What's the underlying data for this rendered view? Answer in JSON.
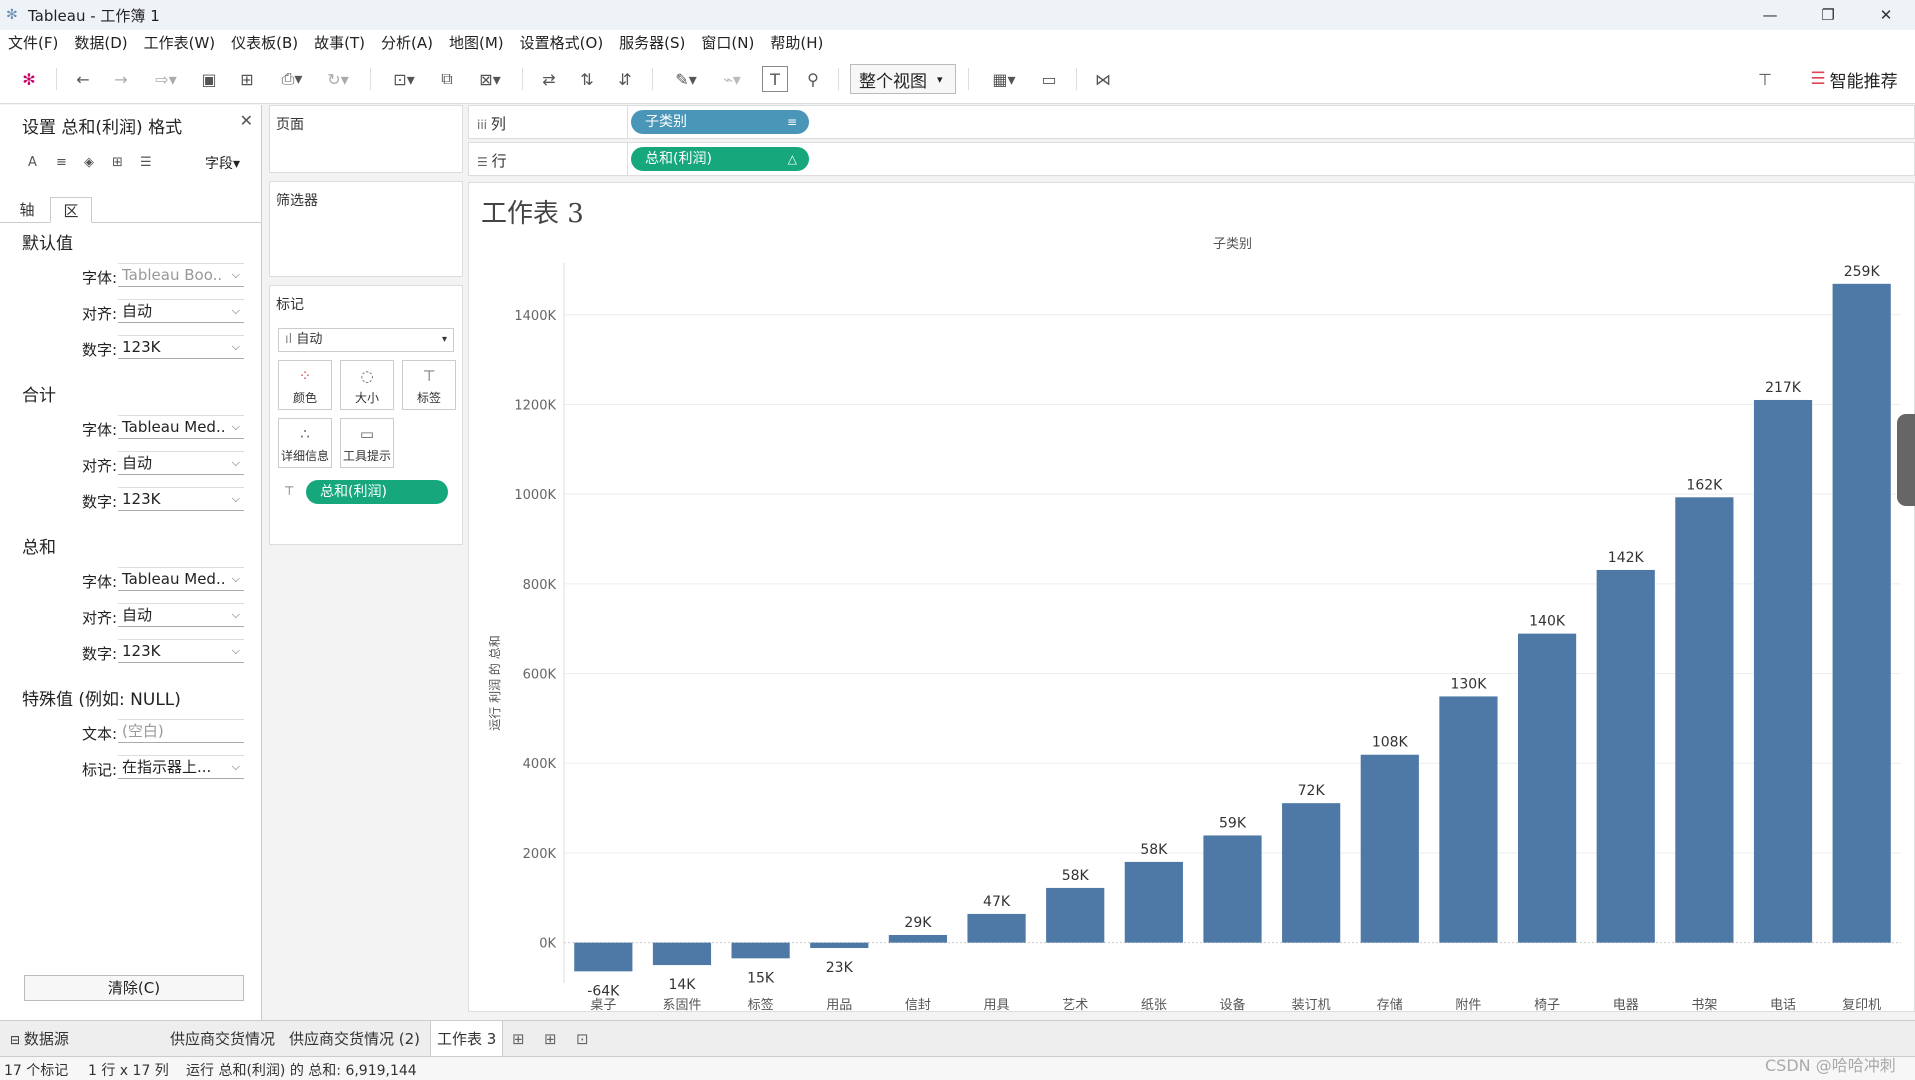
{
  "window": {
    "title": "Tableau - 工作簿 1",
    "minimize": "—",
    "maximize": "❐",
    "close": "✕"
  },
  "menu": [
    "文件(F)",
    "数据(D)",
    "工作表(W)",
    "仪表板(B)",
    "故事(T)",
    "分析(A)",
    "地图(M)",
    "设置格式(O)",
    "服务器(S)",
    "窗口(N)",
    "帮助(H)"
  ],
  "toolbar": {
    "fit_label": "整个视图",
    "show_me_label": "智能推荐"
  },
  "format_pane": {
    "title": "设置 总和(利润) 格式",
    "fields_label": "字段▾",
    "tabs": [
      "轴",
      "区"
    ],
    "sections": [
      {
        "title": "默认值",
        "rows": [
          {
            "label": "字体:",
            "value": "Tableau Boo..",
            "grey": true
          },
          {
            "label": "对齐:",
            "value": "自动"
          },
          {
            "label": "数字:",
            "value": "123K"
          }
        ]
      },
      {
        "title": "合计",
        "rows": [
          {
            "label": "字体:",
            "value": "Tableau Med.."
          },
          {
            "label": "对齐:",
            "value": "自动"
          },
          {
            "label": "数字:",
            "value": "123K"
          }
        ]
      },
      {
        "title": "总和",
        "rows": [
          {
            "label": "字体:",
            "value": "Tableau Med.."
          },
          {
            "label": "对齐:",
            "value": "自动"
          },
          {
            "label": "数字:",
            "value": "123K"
          }
        ]
      },
      {
        "title": "特殊值 (例如: NULL)",
        "rows": [
          {
            "label": "文本:",
            "value": "(空白)",
            "grey": true
          },
          {
            "label": "标记:",
            "value": "在指示器上..."
          }
        ]
      }
    ],
    "clear_label": "清除(C)"
  },
  "shelves": {
    "pages_label": "页面",
    "filters_label": "筛选器",
    "marks_label": "标记",
    "mark_type": "自动",
    "mark_buttons": [
      "颜色",
      "大小",
      "标签",
      "详细信息",
      "工具提示"
    ],
    "mark_pill": "总和(利润)",
    "columns_label": "列",
    "columns_pill": "子类别",
    "rows_label": "行",
    "rows_pill": "总和(利润)"
  },
  "sheet": {
    "title": "工作表 3"
  },
  "chart_data": {
    "type": "bar",
    "title": "",
    "header_label": "子类别",
    "xlabel": "",
    "ylabel": "运行 利润 的 总和",
    "categories": [
      "桌子",
      "系固件",
      "标签",
      "用品",
      "信封",
      "用具",
      "艺术",
      "纸张",
      "设备",
      "装订机",
      "存储",
      "附件",
      "椅子",
      "电器",
      "书架",
      "电话",
      "复印机"
    ],
    "values": [
      -64000,
      -14000,
      -15000,
      -23000,
      29000,
      47000,
      58000,
      58000,
      59000,
      72000,
      108000,
      130000,
      140000,
      142000,
      162000,
      217000,
      259000
    ],
    "running_totals": [
      -64000,
      -50000,
      -35000,
      -12000,
      17000,
      64000,
      122000,
      180000,
      239000,
      311000,
      419000,
      549000,
      689000,
      831000,
      993000,
      1210000,
      1469000
    ],
    "data_labels": [
      "-64K",
      "14K",
      "15K",
      "23K",
      "29K",
      "47K",
      "58K",
      "58K",
      "59K",
      "72K",
      "108K",
      "130K",
      "140K",
      "142K",
      "162K",
      "217K",
      "259K"
    ],
    "y_ticks": [
      "0K",
      "200K",
      "400K",
      "600K",
      "800K",
      "1000K",
      "1200K",
      "1400K"
    ],
    "y_tick_values": [
      0,
      200000,
      400000,
      600000,
      800000,
      1000000,
      1200000,
      1400000
    ],
    "ylim": [
      -90000,
      1560000
    ],
    "bar_color": "#4e79a7",
    "grid": true
  },
  "tabs": {
    "datasource": "数据源",
    "sheets": [
      "供应商交货情况",
      "供应商交货情况 (2)",
      "工作表 3"
    ]
  },
  "status": {
    "marks": "17 个标记",
    "dims": "1 行 x 17 列",
    "sum": "运行 总和(利润) 的 总和: 6,919,144"
  },
  "watermark": "CSDN @哈哈冲刺"
}
